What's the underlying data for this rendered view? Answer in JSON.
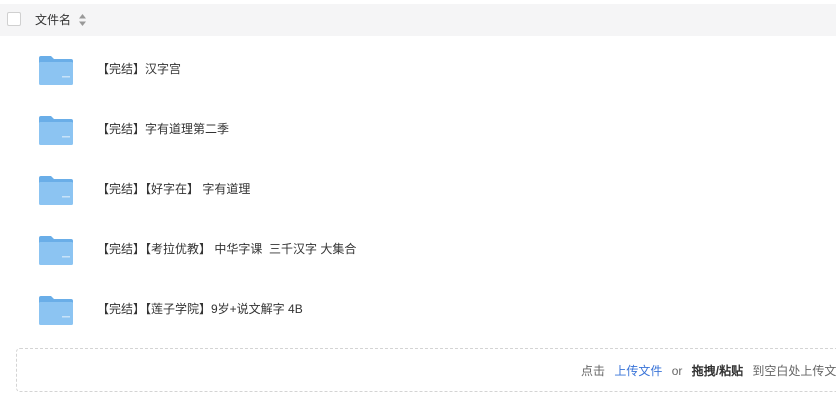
{
  "header": {
    "column_label": "文件名",
    "sort_icon": "sort-up-down-icon"
  },
  "files": [
    {
      "name": "【完结】汉字宫",
      "icon": "folder-icon"
    },
    {
      "name": "【完结】字有道理第二季",
      "icon": "folder-icon"
    },
    {
      "name": "【完结】【好字在】 字有道理",
      "icon": "folder-icon"
    },
    {
      "name": "【完结】【考拉优教】 中华字课  三千汉字 大集合",
      "icon": "folder-icon"
    },
    {
      "name": "【完结】【莲子学院】9岁+说文解字 4B",
      "icon": "folder-icon"
    }
  ],
  "upload": {
    "prefix": "点击",
    "link": "上传文件",
    "or": "or",
    "drag": "拖拽/粘贴",
    "suffix": "到空白处上传文件"
  },
  "colors": {
    "folder_body": "#8cc4f2",
    "folder_tab": "#6aaee8",
    "link": "#3a74d8",
    "header_bg": "#f5f5f6"
  }
}
